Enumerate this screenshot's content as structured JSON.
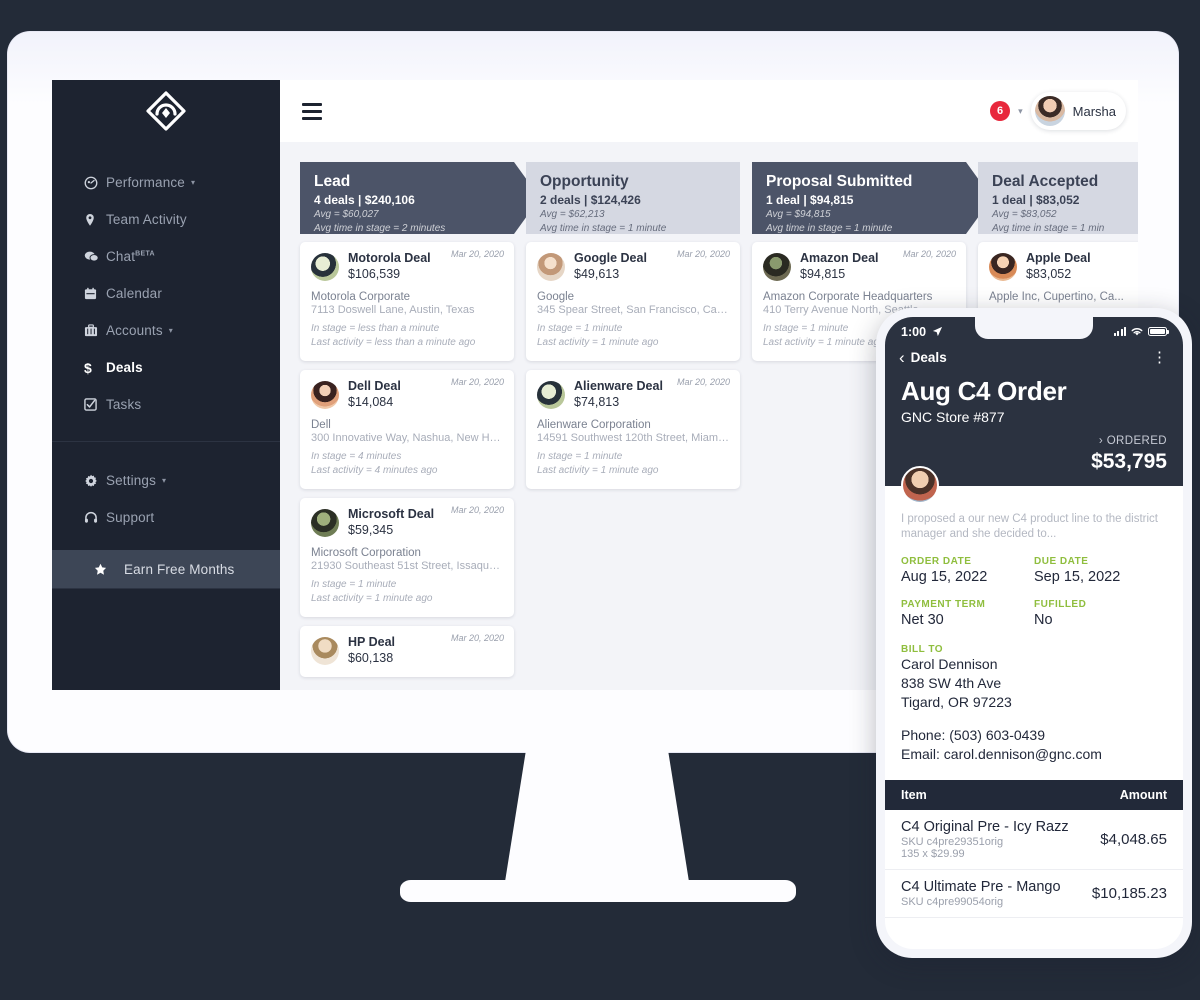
{
  "sidebar": {
    "logo": "shield-diamond-logo",
    "items": [
      {
        "label": "Performance",
        "icon": "gauge-icon",
        "caret": "▾",
        "active": false
      },
      {
        "label": "Team Activity",
        "icon": "pin-icon",
        "caret": "",
        "active": false
      },
      {
        "label": "Chat",
        "sup": "BETA",
        "icon": "chat-icon",
        "caret": "",
        "active": false
      },
      {
        "label": "Calendar",
        "icon": "calendar-icon",
        "caret": "",
        "active": false
      },
      {
        "label": "Accounts",
        "icon": "briefcase-icon",
        "caret": "▾",
        "active": false
      },
      {
        "label": "Deals",
        "icon": "dollar-icon",
        "caret": "",
        "active": true
      },
      {
        "label": "Tasks",
        "icon": "checkbox-icon",
        "caret": "",
        "active": false
      }
    ],
    "bottom_items": [
      {
        "label": "Settings",
        "icon": "gear-icon",
        "caret": "▾"
      },
      {
        "label": "Support",
        "icon": "headset-icon",
        "caret": ""
      }
    ],
    "promo": {
      "label": "Earn Free Months",
      "icon": "star-icon"
    }
  },
  "topbar": {
    "menu_icon": "hamburger-icon",
    "notification_count": "6",
    "notification_caret": "▾",
    "user_name": "Marsha"
  },
  "board": {
    "stages": [
      {
        "title": "Lead",
        "summary": "4 deals | $240,106",
        "avg": "Avg = $60,027",
        "avg_time": "Avg time in stage = 2 minutes",
        "style": "dark",
        "cards": [
          {
            "date": "Mar 20, 2020",
            "title": "Motorola Deal",
            "amount": "$106,539",
            "company": "Motorola Corporate",
            "address": "7113 Doswell Lane, Austin, Texas",
            "in_stage": "In stage = less than a minute",
            "last_activity": "Last activity = less than a minute ago",
            "avatar_color": "#8d8f72"
          },
          {
            "date": "Mar 20, 2020",
            "title": "Dell Deal",
            "amount": "$14,084",
            "company": "Dell",
            "address": "300 Innovative Way, Nashua, New Ha...",
            "in_stage": "In stage = 4 minutes",
            "last_activity": "Last activity = 4 minutes ago",
            "avatar_color": "#c98a63"
          },
          {
            "date": "Mar 20, 2020",
            "title": "Microsoft Deal",
            "amount": "$59,345",
            "company": "Microsoft Corporation",
            "address": "21930 Southeast 51st Street, Issaqua...",
            "in_stage": "In stage = 1 minute",
            "last_activity": "Last activity = 1 minute ago",
            "avatar_color": "#5c6b52"
          },
          {
            "date": "Mar 20, 2020",
            "title": "HP Deal",
            "amount": "$60,138",
            "company": "",
            "address": "",
            "in_stage": "",
            "last_activity": "",
            "avatar_color": "#d8c0a8"
          }
        ]
      },
      {
        "title": "Opportunity",
        "summary": "2 deals | $124,426",
        "avg": "Avg = $62,213",
        "avg_time": "Avg time in stage = 1 minute",
        "style": "light",
        "cards": [
          {
            "date": "Mar 20, 2020",
            "title": "Google Deal",
            "amount": "$49,613",
            "company": "Google",
            "address": "345 Spear Street, San Francisco, Calif...",
            "in_stage": "In stage = 1 minute",
            "last_activity": "Last activity = 1 minute ago",
            "avatar_color": "#cfb9a6"
          },
          {
            "date": "Mar 20, 2020",
            "title": "Alienware Deal",
            "amount": "$74,813",
            "company": "Alienware Corporation",
            "address": "14591 Southwest 120th Street, Miami...",
            "in_stage": "In stage = 1 minute",
            "last_activity": "Last activity = 1 minute ago",
            "avatar_color": "#8d8f72"
          }
        ]
      },
      {
        "title": "Proposal Submitted",
        "summary": "1 deal | $94,815",
        "avg": "Avg = $94,815",
        "avg_time": "Avg time in stage = 1 minute",
        "style": "dark",
        "cards": [
          {
            "date": "Mar 20, 2020",
            "title": "Amazon Deal",
            "amount": "$94,815",
            "company": "Amazon Corporate Headquarters",
            "address": "410 Terry Avenue North, Seattle...",
            "in_stage": "In stage = 1 minute",
            "last_activity": "Last activity = 1 minute ago",
            "avatar_color": "#5e5a4e"
          }
        ]
      },
      {
        "title": "Deal Accepted",
        "summary": "1 deal | $83,052",
        "avg": "Avg = $83,052",
        "avg_time": "Avg time in stage = 1 min",
        "style": "light",
        "cards": [
          {
            "date": "",
            "title": "Apple Deal",
            "amount": "$83,052",
            "company": "Apple Inc, Cupertino, Ca...",
            "address": "",
            "in_stage": "",
            "last_activity": "",
            "avatar_color": "#d4926a"
          }
        ]
      }
    ]
  },
  "phone": {
    "status": {
      "time": "1:00",
      "location_icon": "location-arrow-icon",
      "signal_icon": "signal-bars-icon",
      "wifi_icon": "wifi-icon",
      "battery_icon": "battery-icon"
    },
    "nav": {
      "back_icon": "chevron-left-icon",
      "back_label": "Deals",
      "menu_icon": "kebab-menu-icon"
    },
    "order": {
      "title": "Aug C4 Order",
      "store": "GNC Store #877",
      "status_label": "ORDERED",
      "status_chevron": "›",
      "total": "$53,795",
      "note": "I proposed a our new C4 product line to the district manager and she decided to...",
      "fields": [
        {
          "label": "ORDER DATE",
          "value": "Aug 15, 2022"
        },
        {
          "label": "DUE DATE",
          "value": "Sep 15, 2022"
        },
        {
          "label": "PAYMENT TERM",
          "value": "Net 30"
        },
        {
          "label": "FUFILLED",
          "value": "No"
        }
      ],
      "bill_to_label": "BILL TO",
      "bill_to": [
        "Carol Dennison",
        "838 SW 4th Ave",
        "Tigard, OR 97223"
      ],
      "phone": "Phone: (503) 603-0439",
      "email": "Email: carol.dennison@gnc.com",
      "items_header": {
        "item": "Item",
        "amount": "Amount"
      },
      "items": [
        {
          "name": "C4 Original Pre - Icy Razz",
          "sku": "SKU c4pre29351orig",
          "qty": "135 x $29.99",
          "amount": "$4,048.65"
        },
        {
          "name": "C4 Ultimate Pre - Mango",
          "sku": "SKU c4pre99054orig",
          "qty": "",
          "amount": "$10,185.23"
        }
      ]
    }
  },
  "colors": {
    "background": "#232b38",
    "sidebar": "#1d2330",
    "stage_dark": "#4c5468",
    "stage_light": "#d5d8e2",
    "accent_green": "#8fbe3e",
    "badge_red": "#e8283c"
  }
}
